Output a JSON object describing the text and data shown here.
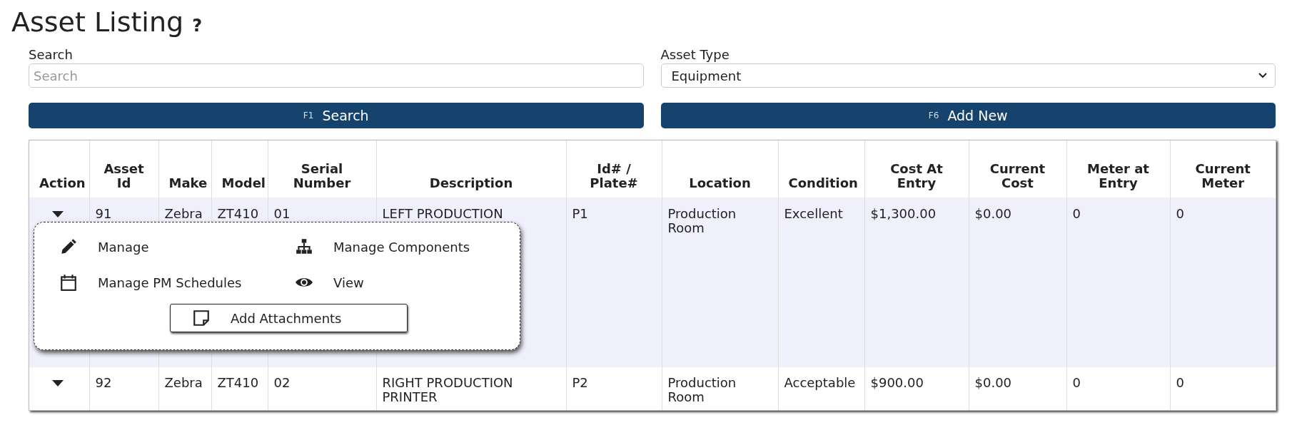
{
  "title": "Asset Listing",
  "help": "?",
  "search": {
    "label": "Search",
    "placeholder": "Search"
  },
  "asset_type": {
    "label": "Asset Type",
    "value": "Equipment"
  },
  "buttons": [
    {
      "key": "F1",
      "label": "Search"
    },
    {
      "key": "F6",
      "label": "Add New"
    }
  ],
  "table": {
    "columns": [
      "Action",
      "Asset Id",
      "Make",
      "Model",
      "Serial Number",
      "Description",
      "Id# / Plate#",
      "Location",
      "Condition",
      "Cost At Entry",
      "Current Cost",
      "Meter at Entry",
      "Current Meter"
    ],
    "rows": [
      {
        "selected": true,
        "cells": [
          "",
          "91",
          "Zebra",
          "ZT410",
          "01",
          "LEFT PRODUCTION",
          "P1",
          "Production Room",
          "Excellent",
          "$1,300.00",
          "$0.00",
          "0",
          "0"
        ],
        "menu": {
          "items": [
            {
              "kind": "pencil",
              "label": "Manage",
              "selected": false
            },
            {
              "kind": "sitemap",
              "label": "Manage Components",
              "selected": false
            },
            {
              "kind": "calendar",
              "label": "Manage PM Schedules",
              "selected": false
            },
            {
              "kind": "eye",
              "label": "View",
              "selected": false
            },
            {
              "kind": "note",
              "label": "Add Attachments",
              "selected": true
            }
          ]
        }
      },
      {
        "selected": false,
        "cells": [
          "",
          "92",
          "Zebra",
          "ZT410",
          "02",
          "RIGHT PRODUCTION PRINTER",
          "P2",
          "Production Room",
          "Acceptable",
          "$900.00",
          "$0.00",
          "0",
          "0"
        ]
      }
    ]
  }
}
